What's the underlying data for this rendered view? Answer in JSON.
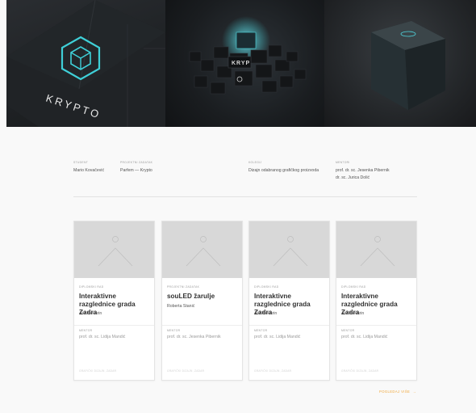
{
  "hero": {
    "panel1_text": "KRYPTO",
    "panel2_text": "KRYP"
  },
  "meta": {
    "student": {
      "label": "STUDENT",
      "value": "Mario Kovačević"
    },
    "assignment": {
      "label": "PROJEKTNI ZADATAK",
      "value": "Parfem — Krypto"
    },
    "course": {
      "label": "KOLEGIJ",
      "value": "Dizajn odabranog grafičkog proizvoda"
    },
    "mentors": {
      "label": "MENTORI",
      "values": [
        "prof. dr. sc. Jesenka Pibernik",
        "dr. sc. Jurica Dolić"
      ]
    }
  },
  "cards": [
    {
      "category": "DIPLOMSKI RAD",
      "title": "Interaktivne razglednice grada Zadra",
      "author": "Ana Beverin",
      "mentor_label": "MENTOR",
      "mentor": "prof. dr. sc. Lidija Mandić",
      "footer": "GRAFIČKI DIZAJN, ZADAR"
    },
    {
      "category": "PROJEKTNI ZADATAK",
      "title": "souLED žarulje",
      "author": "Roberta Stanić",
      "mentor_label": "MENTOR",
      "mentor": "prof. dr. sc. Jesenka Pibernik",
      "footer": "GRAFIČKI DIZAJN, ZADAR"
    },
    {
      "category": "DIPLOMSKI RAD",
      "title": "Interaktivne razglednice grada Zadra",
      "author": "Ana Beverin",
      "mentor_label": "MENTOR",
      "mentor": "prof. dr. sc. Lidija Mandić",
      "footer": "GRAFIČKI DIZAJN, ZADAR"
    },
    {
      "category": "DIPLOMSKI RAD",
      "title": "Interaktivne razglednice grada Zadra",
      "author": "Ana Beverin",
      "mentor_label": "MENTOR",
      "mentor": "prof. dr. sc. Lidija Mandić",
      "footer": "GRAFIČKI DIZAJN, ZADAR"
    }
  ],
  "more_link": "POGLEDAJ VIŠE",
  "colors": {
    "accent": "#f0a83a",
    "glow": "#3fd0d8",
    "placeholder": "#d8d8d8"
  },
  "icons": [
    "image-placeholder-icon",
    "arrow-right-icon",
    "hexagon-cube-logo-icon"
  ]
}
